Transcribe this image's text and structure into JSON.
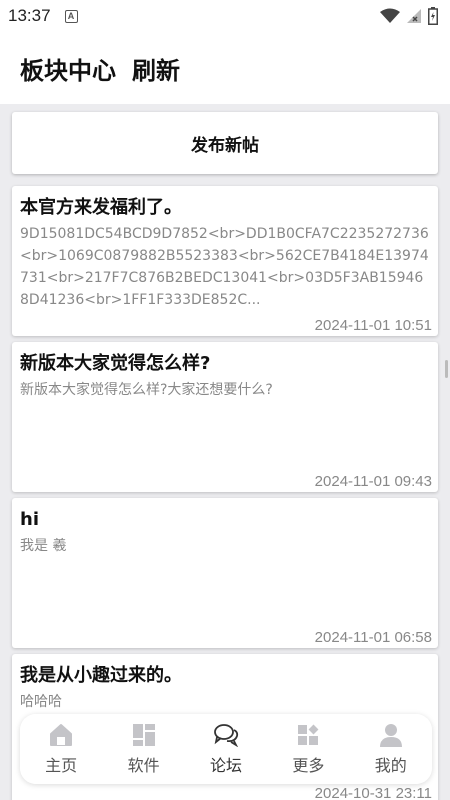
{
  "status": {
    "time": "13:37"
  },
  "header": {
    "title": "板块中心",
    "refresh": "刷新"
  },
  "new_post_label": "发布新帖",
  "posts": [
    {
      "title": "本官方来发福利了。",
      "body": "9D15081DC54BCD9D7852<br>DD1B0CFA7C2235272736<br>1069C0879882B5523383<br>562CE7B4184E13974731<br>217F7C876B2BEDC13041<br>03D5F3AB159468D41236<br>1FF1F333DE852C...",
      "date": "2024-11-01 10:51"
    },
    {
      "title": "新版本大家觉得怎么样?",
      "body": "新版本大家觉得怎么样?大家还想要什么?",
      "date": "2024-11-01 09:43"
    },
    {
      "title": "hi",
      "body": "我是 羲",
      "date": "2024-11-01 06:58"
    },
    {
      "title": "我是从小趣过来的。",
      "body": "哈哈哈",
      "date": "2024-10-31 23:11"
    }
  ],
  "nav": [
    {
      "label": "主页",
      "icon": "home-icon"
    },
    {
      "label": "软件",
      "icon": "apps-icon"
    },
    {
      "label": "论坛",
      "icon": "chat-icon"
    },
    {
      "label": "更多",
      "icon": "more-icon"
    },
    {
      "label": "我的",
      "icon": "person-icon"
    }
  ]
}
